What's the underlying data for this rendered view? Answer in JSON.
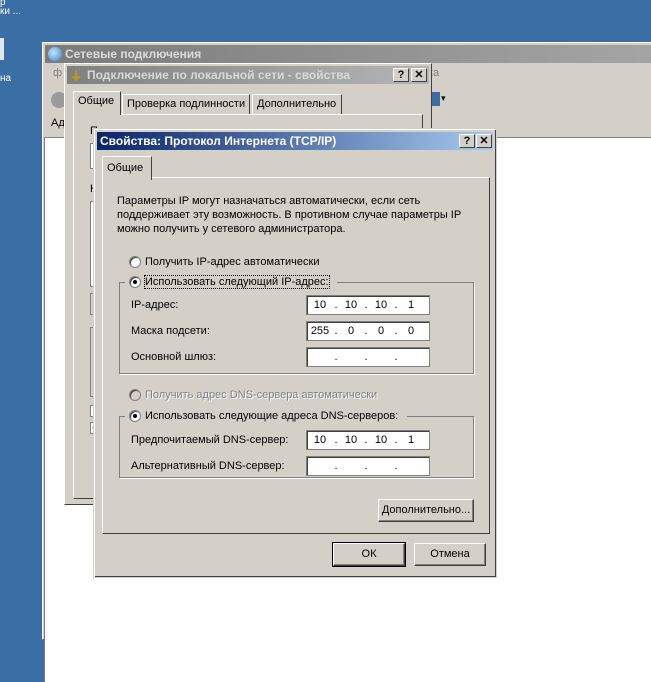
{
  "desktop": {
    "text1": "р",
    "text2": "ки ...",
    "text3": "на"
  },
  "net_window": {
    "title": "Сетевые подключения",
    "menu_first": "ф",
    "menu_partial": "ка",
    "toolbar_back": "",
    "address_label": "Ад",
    "left_glyph1": "Л",
    "left_glyph2": "М"
  },
  "lan_window": {
    "title": "Подключение по локальной сети - свойства",
    "help_btn": "?",
    "close_btn": "✕",
    "tabs": [
      "Общие",
      "Проверка подлинности",
      "Дополнительно"
    ],
    "partial_labels": [
      "П",
      "К"
    ]
  },
  "tcp_dialog": {
    "title": "Свойства: Протокол Интернета (TCP/IP)",
    "help_btn": "?",
    "close_btn": "✕",
    "tab": "Общие",
    "description": "Параметры IP могут назначаться автоматически, если сеть поддерживает эту возможность. В противном случае параметры IP можно получить у сетевого администратора.",
    "ip_auto_label": "Получить IP-адрес автоматически",
    "ip_manual_label": "Использовать следующий IP-адрес:",
    "ip_address_label": "IP-адрес:",
    "ip_address": [
      "10",
      "10",
      "10",
      "1"
    ],
    "subnet_label": "Маска подсети:",
    "subnet": [
      "255",
      "0",
      "0",
      "0"
    ],
    "gateway_label": "Основной шлюз:",
    "gateway": [
      "",
      "",
      "",
      ""
    ],
    "dns_auto_label": "Получить адрес DNS-сервера автоматически",
    "dns_manual_label": "Использовать следующие адреса DNS-серверов:",
    "dns_pref_label": "Предпочитаемый DNS-сервер:",
    "dns_pref": [
      "10",
      "10",
      "10",
      "1"
    ],
    "dns_alt_label": "Альтернативный DNS-сервер:",
    "dns_alt": [
      "",
      "",
      "",
      ""
    ],
    "advanced_btn": "Дополнительно...",
    "ok_btn": "ОК",
    "cancel_btn": "Отмена",
    "selected_ip_mode": "manual",
    "selected_dns_mode": "manual"
  }
}
